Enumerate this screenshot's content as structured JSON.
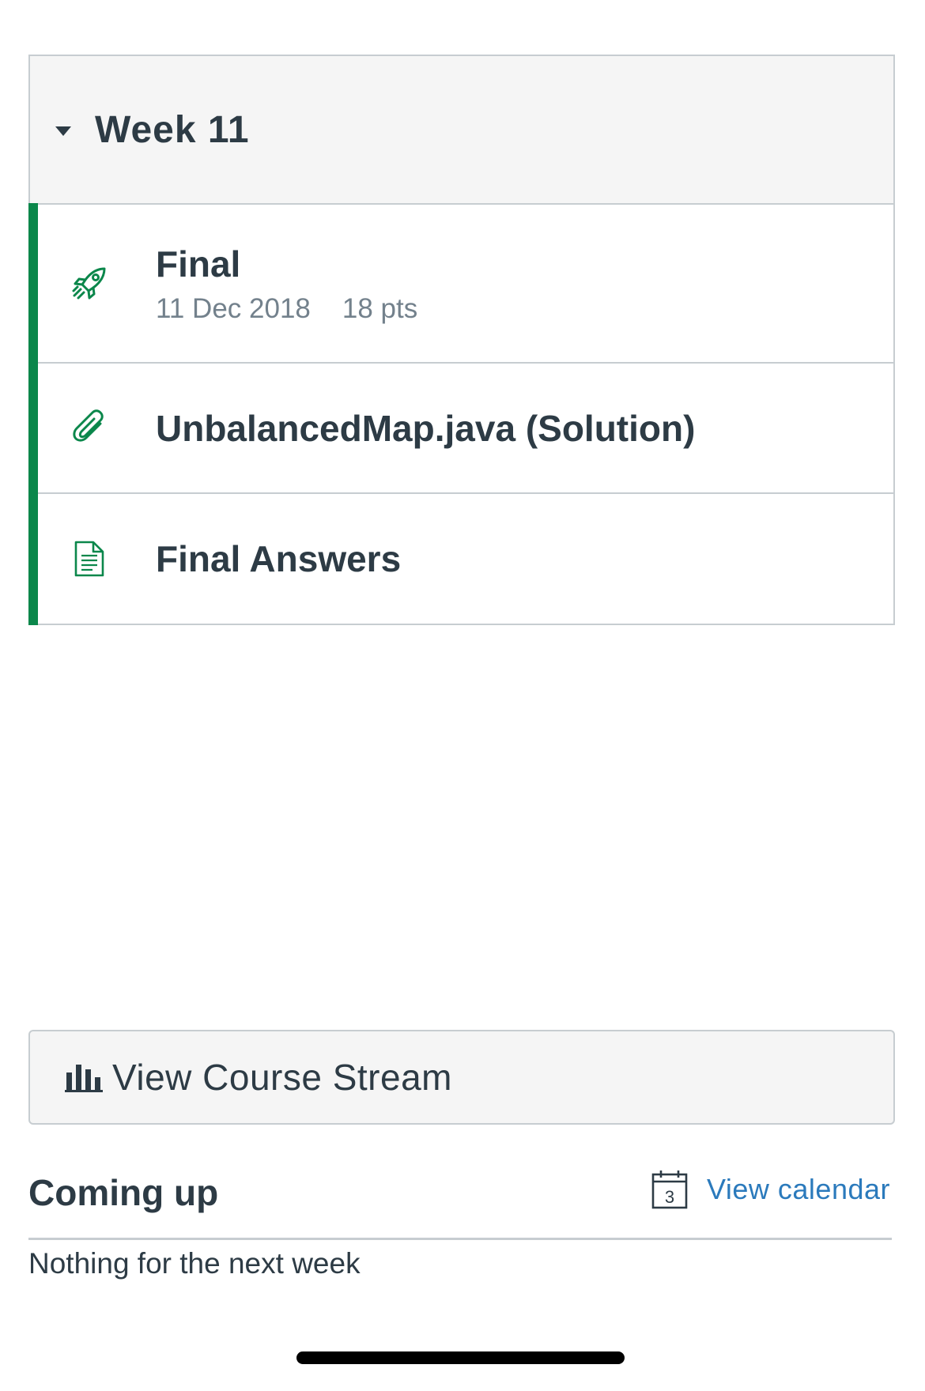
{
  "module": {
    "title": "Week 11",
    "accent_color": "#0b874b",
    "items": [
      {
        "type": "quiz",
        "icon": "rocket-icon",
        "title": "Final",
        "date": "11 Dec 2018",
        "points": "18 pts"
      },
      {
        "type": "attachment",
        "icon": "paperclip-icon",
        "title": "UnbalancedMap.java (Solution)"
      },
      {
        "type": "page",
        "icon": "document-icon",
        "title": "Final Answers"
      }
    ]
  },
  "stream_button": {
    "label": "View Course Stream",
    "icon": "bar-chart-icon"
  },
  "coming_up": {
    "title": "Coming up",
    "view_calendar_label": "View calendar",
    "calendar_icon_day": "3",
    "empty_text": "Nothing for the next week",
    "link_color": "#2b7abc"
  }
}
